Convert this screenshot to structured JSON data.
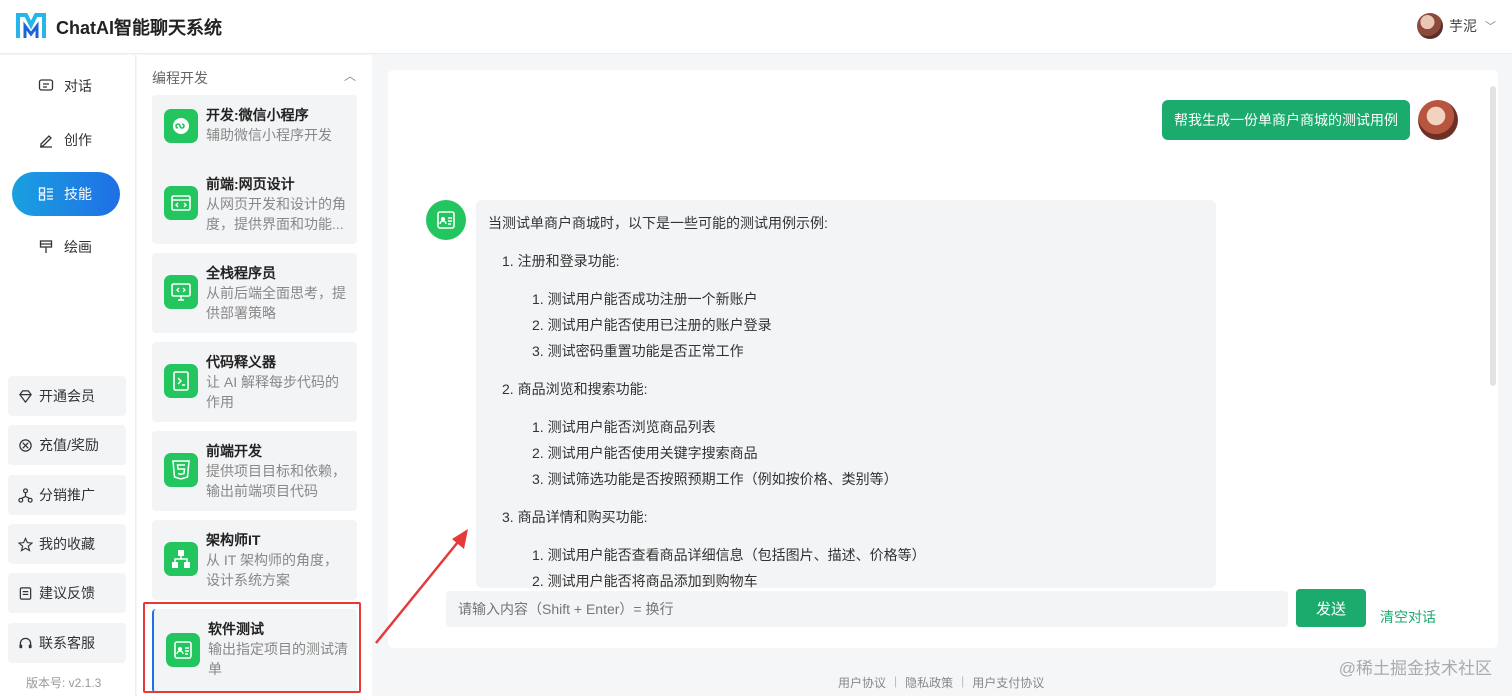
{
  "app": {
    "title": "ChatAI智能聊天系统"
  },
  "user": {
    "name": "芋泥"
  },
  "nav": {
    "items": [
      {
        "label": "对话",
        "icon": "chat-icon"
      },
      {
        "label": "创作",
        "icon": "edit-icon"
      },
      {
        "label": "技能",
        "icon": "skills-icon",
        "active": true
      },
      {
        "label": "绘画",
        "icon": "brush-icon"
      }
    ],
    "buttons": [
      {
        "label": "开通会员",
        "icon": "diamond-icon"
      },
      {
        "label": "充值/奖励",
        "icon": "gift-icon"
      },
      {
        "label": "分销推广",
        "icon": "share-icon"
      },
      {
        "label": "我的收藏",
        "icon": "star-icon"
      },
      {
        "label": "建议反馈",
        "icon": "feedback-icon"
      },
      {
        "label": "联系客服",
        "icon": "headset-icon"
      }
    ],
    "version": "版本号: v2.1.3"
  },
  "skills": {
    "category": "编程开发",
    "cards": [
      {
        "title": "开发:微信小程序",
        "desc": "辅助微信小程序开发",
        "icon": "miniprogram-icon"
      },
      {
        "title": "前端:网页设计",
        "desc": "从网页开发和设计的角度，提供界面和功能...",
        "icon": "webpage-icon"
      },
      {
        "title": "全栈程序员",
        "desc": "从前后端全面思考，提供部署策略",
        "icon": "monitor-code-icon"
      },
      {
        "title": "代码释义器",
        "desc": "让 AI 解释每步代码的作用",
        "icon": "terminal-icon"
      },
      {
        "title": "前端开发",
        "desc": "提供项目目标和依赖，输出前端项目代码",
        "icon": "html5-icon"
      },
      {
        "title": "架构师IT",
        "desc": "从 IT 架构师的角度，设计系统方案",
        "icon": "architecture-icon"
      },
      {
        "title": "软件测试",
        "desc": "输出指定项目的测试清单",
        "icon": "test-icon",
        "selected": true
      }
    ]
  },
  "chat": {
    "user_message": "帮我生成一份单商户商城的测试用例",
    "bot": {
      "intro": "当测试单商户商城时，以下是一些可能的测试用例示例:",
      "sections": [
        {
          "title": "1. 注册和登录功能:",
          "items": [
            "1. 测试用户能否成功注册一个新账户",
            "2. 测试用户能否使用已注册的账户登录",
            "3. 测试密码重置功能是否正常工作"
          ]
        },
        {
          "title": "2. 商品浏览和搜索功能:",
          "items": [
            "1. 测试用户能否浏览商品列表",
            "2. 测试用户能否使用关键字搜索商品",
            "3. 测试筛选功能是否按照预期工作（例如按价格、类别等）"
          ]
        },
        {
          "title": "3. 商品详情和购买功能:",
          "items": [
            "1. 测试用户能否查看商品详细信息（包括图片、描述、价格等）",
            "2. 测试用户能否将商品添加到购物车"
          ]
        }
      ]
    },
    "input_placeholder": "请输入内容（Shift + Enter）= 换行",
    "send_label": "发送",
    "clear_label": "清空对话"
  },
  "footer": {
    "links": [
      "用户协议",
      "隐私政策",
      "用户支付协议"
    ]
  },
  "watermark": "@稀土掘金技术社区",
  "colors": {
    "accent": "#1aab6d",
    "nav_active": "#1f6fe5",
    "highlight": "#e63a3a"
  }
}
